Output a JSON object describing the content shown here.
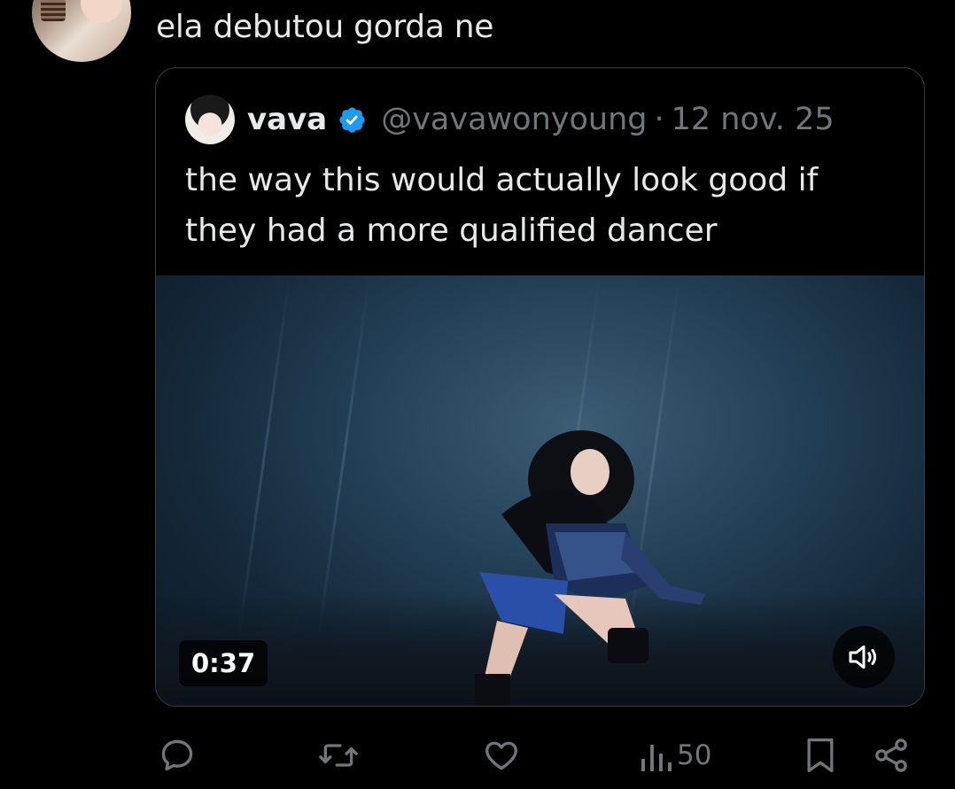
{
  "reply": {
    "text": "ela debutou gorda ne",
    "avatar_icon": "user-avatar"
  },
  "quoted_tweet": {
    "name": "vava",
    "verified": true,
    "verified_color": "#1d9bf0",
    "handle": "@vavawonyoung",
    "separator": "·",
    "date": "12 nov. 25",
    "text": "the way this would actually look good if they had a more qualified dancer",
    "video": {
      "duration": "0:37",
      "volume_icon": "speaker-icon"
    }
  },
  "actions": {
    "reply_icon": "reply-icon",
    "retweet_icon": "retweet-icon",
    "like_icon": "heart-icon",
    "views_icon": "views-icon",
    "views_count": "50",
    "bookmark_icon": "bookmark-icon",
    "share_icon": "share-icon"
  },
  "colors": {
    "background": "#000000",
    "text_primary": "#e7e9ea",
    "text_secondary": "#71767b",
    "border": "#3a3d40"
  }
}
